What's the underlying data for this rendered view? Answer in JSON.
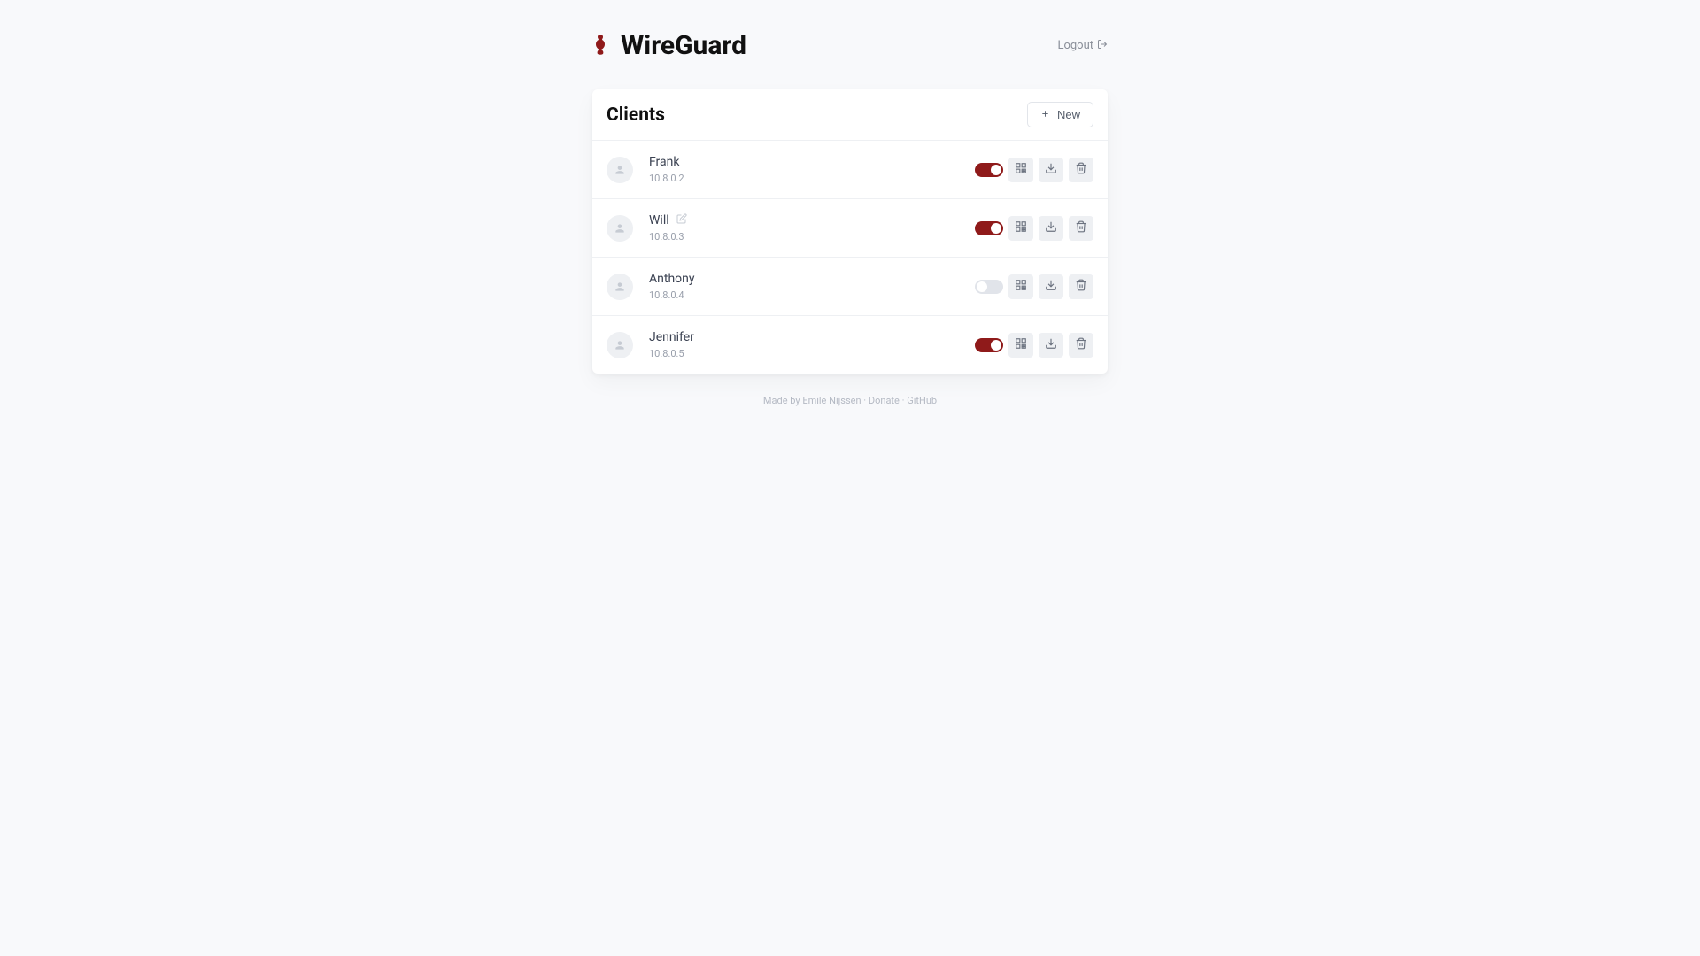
{
  "header": {
    "title": "WireGuard",
    "logout": "Logout"
  },
  "panel": {
    "title": "Clients",
    "new_label": "New"
  },
  "clients": [
    {
      "name": "Frank",
      "ip": "10.8.0.2",
      "enabled": true,
      "editing": false
    },
    {
      "name": "Will",
      "ip": "10.8.0.3",
      "enabled": true,
      "editing": true
    },
    {
      "name": "Anthony",
      "ip": "10.8.0.4",
      "enabled": false,
      "editing": false
    },
    {
      "name": "Jennifer",
      "ip": "10.8.0.5",
      "enabled": true,
      "editing": false
    }
  ],
  "footer": {
    "made_by_prefix": "Made by ",
    "author": "Emile Nijssen",
    "donate": "Donate",
    "github": "GitHub",
    "sep": " · "
  }
}
